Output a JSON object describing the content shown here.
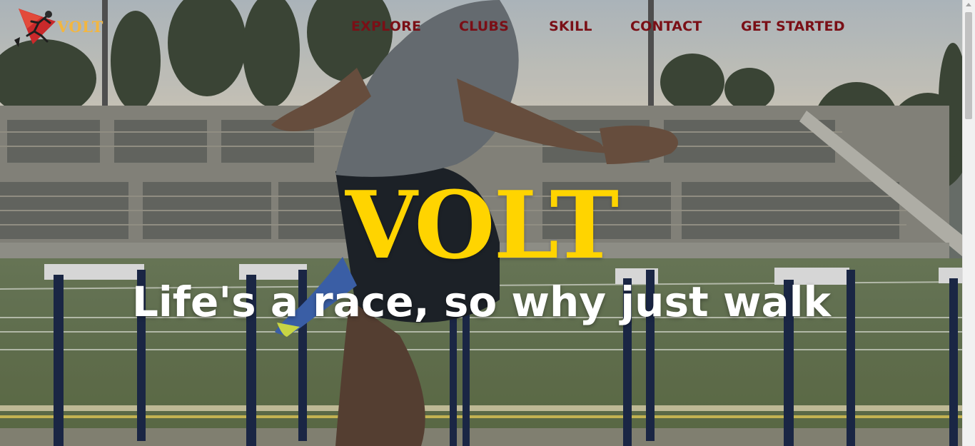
{
  "brand": {
    "name": "VOLT",
    "logo_icon": "sprinter-logo-icon",
    "accent": "#f2b640"
  },
  "nav": {
    "items": [
      {
        "label": "EXPLORE"
      },
      {
        "label": "CLUBS"
      },
      {
        "label": "SKILL"
      },
      {
        "label": "CONTACT"
      },
      {
        "label": "GET STARTED"
      }
    ],
    "color": "#7a0f16"
  },
  "hero": {
    "title": "VOLT",
    "tagline": "Life's a race, so why just walk",
    "title_color": "#ffd400",
    "tagline_color": "#ffffff",
    "background": "athlete-hurdles-video"
  }
}
